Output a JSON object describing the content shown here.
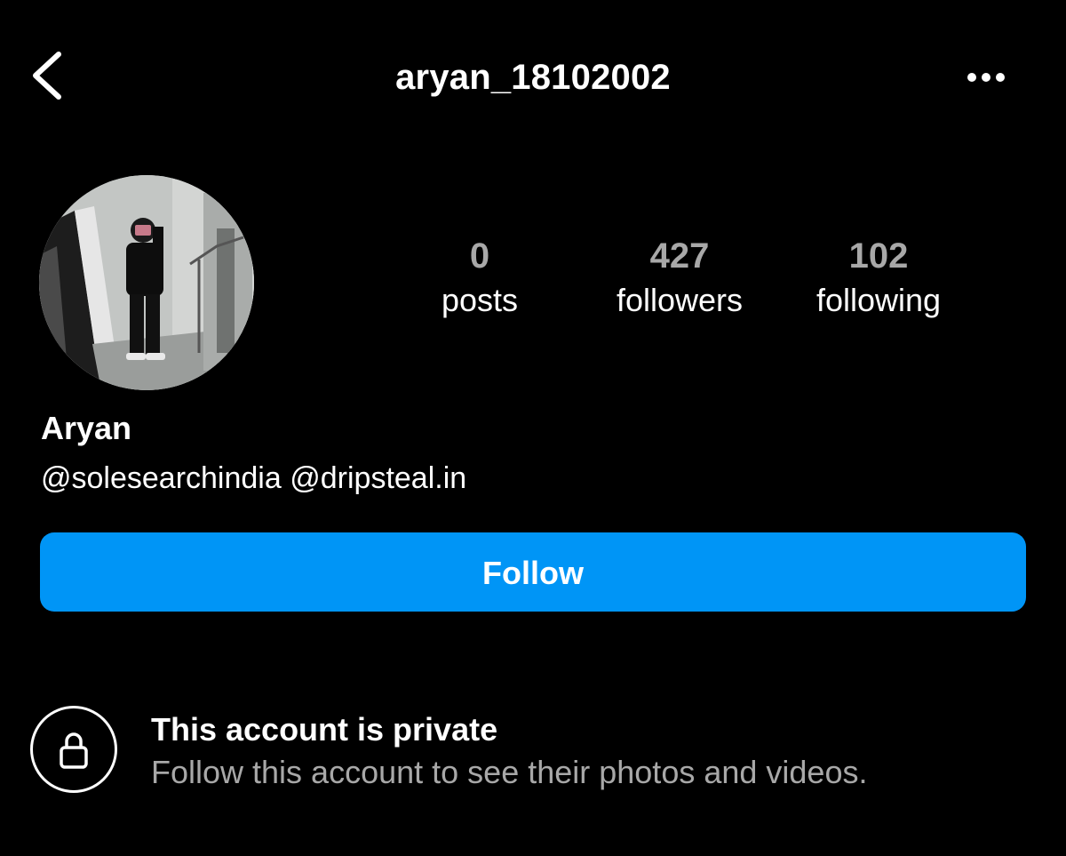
{
  "header": {
    "back_icon": "chevron-left-icon",
    "username": "aryan_18102002",
    "more_icon": "more-horizontal-icon"
  },
  "profile": {
    "avatar_icon": "profile-photo",
    "stats": {
      "posts": {
        "count": "0",
        "label": "posts"
      },
      "followers": {
        "count": "427",
        "label": "followers"
      },
      "following": {
        "count": "102",
        "label": "following"
      }
    },
    "display_name": "Aryan",
    "bio": {
      "mention_1": "@solesearchindia",
      "mention_2": "@dripsteal.in"
    },
    "follow_label": "Follow"
  },
  "private_notice": {
    "icon": "lock-icon",
    "title": "This account is private",
    "subtitle": "Follow this account to see their photos and videos."
  },
  "colors": {
    "background": "#000000",
    "accent": "#0095f6",
    "secondary_text": "#a8a8a8",
    "primary_text": "#ffffff"
  }
}
